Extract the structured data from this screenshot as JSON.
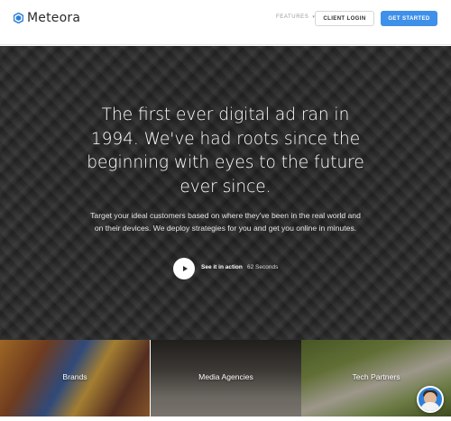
{
  "header": {
    "logo_text": "Meteora",
    "logo_icon": "hexagon-icon",
    "nav_features": "FEATURES",
    "client_login": "CLIENT LOGIN",
    "get_started": "GET STARTED"
  },
  "hero": {
    "title": "The first ever digital ad ran in 1994. We've had roots since the beginning with eyes to the future ever since.",
    "subtitle": "Target your ideal customers based on where they've been in the real world and on their devices. We deploy strategies for you and get you online in minutes.",
    "see_action": "See it in action",
    "duration": "62 Seconds",
    "play_icon": "play-icon"
  },
  "tiles": [
    {
      "label": "Brands"
    },
    {
      "label": "Media Agencies"
    },
    {
      "label": "Tech Partners"
    }
  ],
  "chat": {
    "icon": "chat-avatar"
  },
  "colors": {
    "accent": "#3f90e9",
    "header_bg": "#ffffff",
    "hero_text": "#ffffff"
  }
}
